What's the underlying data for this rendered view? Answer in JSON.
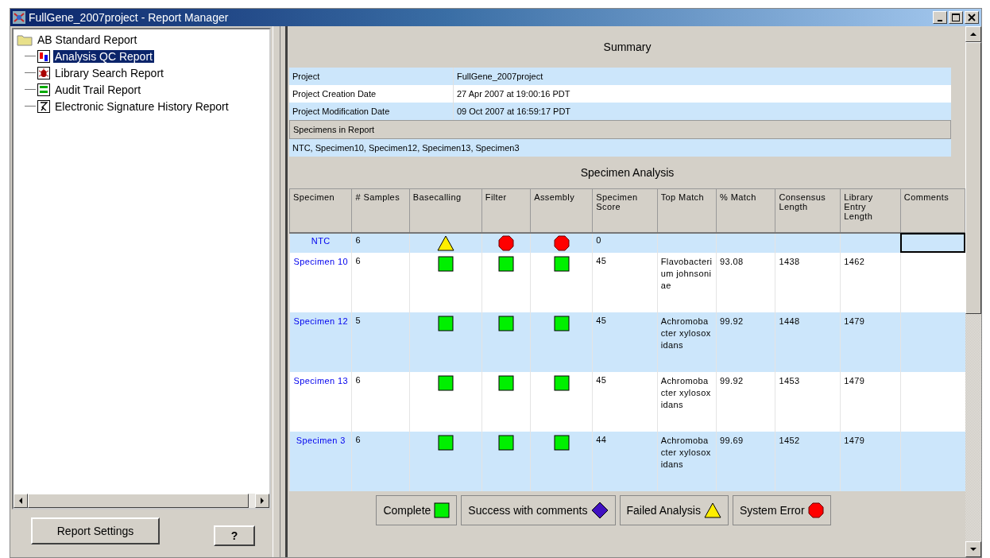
{
  "window": {
    "title": "FullGene_2007project - Report Manager"
  },
  "tree": {
    "label": "AB Standard Report",
    "kind": "folder",
    "selected": false,
    "children": [
      {
        "label": "Analysis QC Report",
        "kind": "qc",
        "selected": true
      },
      {
        "label": "Library Search Report",
        "kind": "bug",
        "selected": false
      },
      {
        "label": "Audit Trail Report",
        "kind": "audit",
        "selected": false
      },
      {
        "label": "Electronic Signature History Report",
        "kind": "signature",
        "selected": false
      }
    ]
  },
  "buttons": {
    "settings": "Report Settings",
    "help": "?"
  },
  "summary": {
    "title": "Summary",
    "fields": [
      {
        "label": "Project",
        "value": "FullGene_2007project"
      },
      {
        "label": "Project Creation Date",
        "value": "27 Apr 2007 at 19:00:16 PDT"
      },
      {
        "label": "Project Modification Date",
        "value": "09 Oct 2007 at 16:59:17 PDT"
      }
    ],
    "specimens_heading": "Specimens in Report",
    "specimens": "NTC, Specimen10, Specimen12, Specimen13, Specimen3"
  },
  "analysis": {
    "title": "Specimen Analysis",
    "columns": [
      "Specimen",
      "# Samples",
      "Basecalling",
      "Filter",
      "Assembly",
      "Specimen Score",
      "Top Match",
      "% Match",
      "Consensus Length",
      "Library Entry Length",
      "Comments"
    ],
    "rows": [
      {
        "specimen": "NTC",
        "samples": "6",
        "basecalling": {
          "kind": "failed"
        },
        "filter": {
          "kind": "error"
        },
        "assembly": {
          "kind": "error"
        },
        "score": "0",
        "top_match": "",
        "match": "",
        "consensus": "",
        "library": "",
        "focused": true
      },
      {
        "specimen": "Specimen 10",
        "samples": "6",
        "basecalling": {
          "kind": "complete"
        },
        "filter": {
          "kind": "complete"
        },
        "assembly": {
          "kind": "complete"
        },
        "score": "45",
        "top_match": "Flavobacterium johnsoniae",
        "match": "93.08",
        "consensus": "1438",
        "library": "1462",
        "focused": false
      },
      {
        "specimen": "Specimen 12",
        "samples": "5",
        "basecalling": {
          "kind": "complete"
        },
        "filter": {
          "kind": "complete"
        },
        "assembly": {
          "kind": "complete"
        },
        "score": "45",
        "top_match": "Achromobacter xylosoxidans",
        "match": "99.92",
        "consensus": "1448",
        "library": "1479",
        "focused": false
      },
      {
        "specimen": "Specimen 13",
        "samples": "6",
        "basecalling": {
          "kind": "complete"
        },
        "filter": {
          "kind": "complete"
        },
        "assembly": {
          "kind": "complete"
        },
        "score": "45",
        "top_match": "Achromobacter xylosoxidans",
        "match": "99.92",
        "consensus": "1453",
        "library": "1479",
        "focused": false
      },
      {
        "specimen": "Specimen 3",
        "samples": "6",
        "basecalling": {
          "kind": "complete"
        },
        "filter": {
          "kind": "complete"
        },
        "assembly": {
          "kind": "complete"
        },
        "score": "44",
        "top_match": "Achromobacter xylosoxidans",
        "match": "99.69",
        "consensus": "1452",
        "library": "1479",
        "focused": false
      }
    ]
  },
  "legend": [
    {
      "label": "Complete",
      "kind": "complete"
    },
    {
      "label": "Success with comments",
      "kind": "comments"
    },
    {
      "label": "Failed Analysis",
      "kind": "failed"
    },
    {
      "label": "System Error",
      "kind": "error"
    }
  ]
}
